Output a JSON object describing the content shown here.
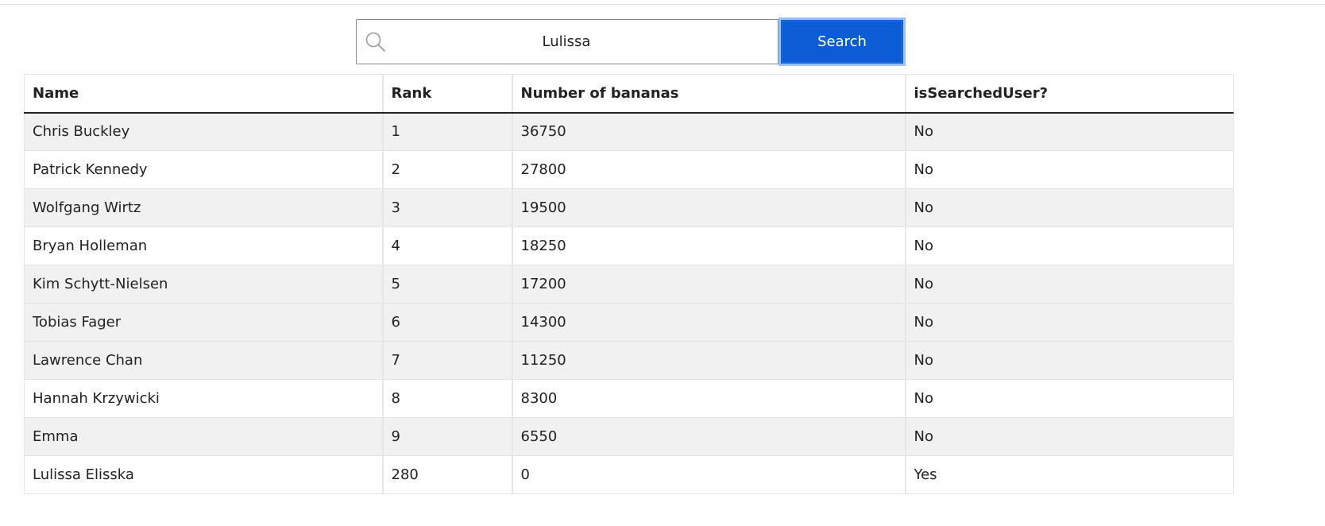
{
  "search": {
    "value": "Lulissa",
    "button_label": "Search"
  },
  "table": {
    "headers": [
      "Name",
      "Rank",
      "Number of bananas",
      "isSearchedUser?"
    ],
    "rows": [
      [
        "Chris Buckley",
        "1",
        "36750",
        "No"
      ],
      [
        "Patrick Kennedy",
        "2",
        "27800",
        "No"
      ],
      [
        "Wolfgang Wirtz",
        "3",
        "19500",
        "No"
      ],
      [
        "Bryan Holleman",
        "4",
        "18250",
        "No"
      ],
      [
        "Kim Schytt-Nielsen",
        "5",
        "17200",
        "No"
      ],
      [
        "Tobias Fager",
        "6",
        "14300",
        "No"
      ],
      [
        "Lawrence Chan",
        "7",
        "11250",
        "No"
      ],
      [
        "Hannah Krzywicki",
        "8",
        "8300",
        "No"
      ],
      [
        "Emma",
        "9",
        "6550",
        "No"
      ],
      [
        "Lulissa Elisska",
        "280",
        "0",
        "Yes"
      ]
    ]
  },
  "colors": {
    "button_bg": "#0b5cd5",
    "button_focus_ring": "#9bc3f5",
    "row_stripe": "#f1f1f1"
  },
  "icons": {
    "search": "search-icon"
  }
}
